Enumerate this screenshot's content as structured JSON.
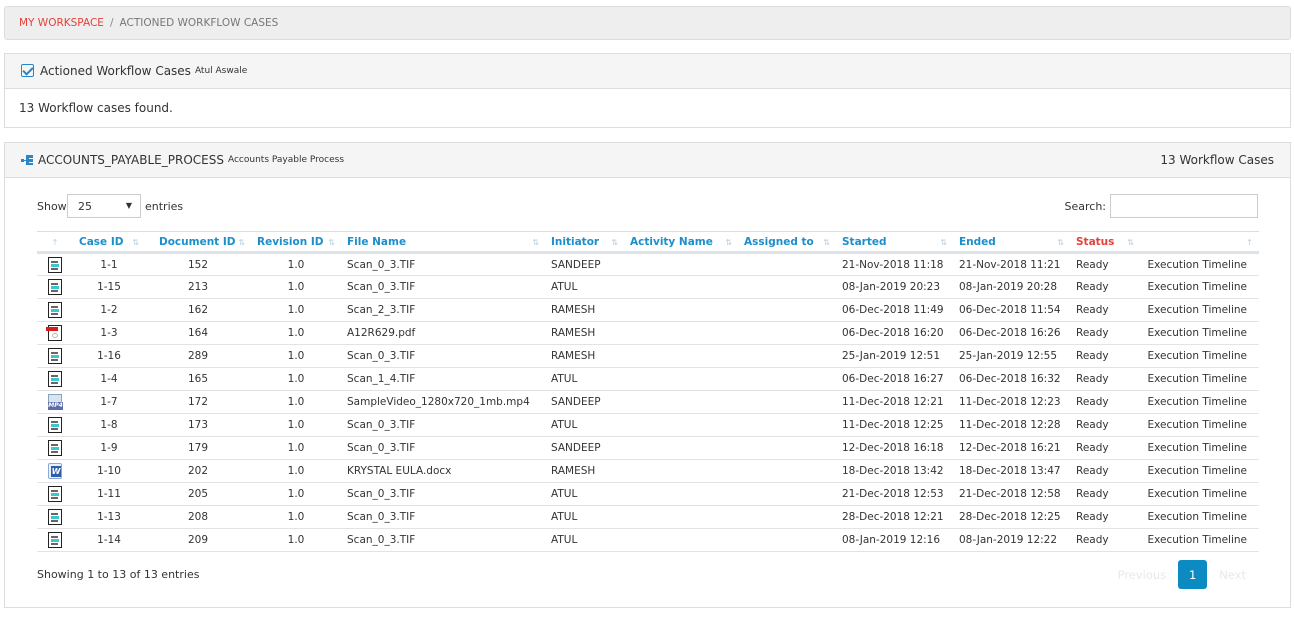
{
  "breadcrumb": {
    "home": "MY WORKSPACE",
    "separator": "/",
    "current": "ACTIONED WORKFLOW CASES"
  },
  "summary_panel": {
    "title": "Actioned Workflow Cases",
    "user": "Atul Aswale",
    "message": "13 Workflow cases found."
  },
  "process_panel": {
    "process_code": "ACCOUNTS_PAYABLE_PROCESS",
    "process_name": "Accounts Payable Process",
    "count_label": "13 Workflow Cases",
    "show_label": "Show",
    "page_length": "25",
    "entries_label": "entries",
    "search_label": "Search:",
    "search_value": "",
    "columns": [
      "",
      "Case ID",
      "Document ID",
      "Revision ID",
      "File Name",
      "Initiator",
      "Activity Name",
      "Assigned to",
      "Started",
      "Ended",
      "Status",
      ""
    ],
    "rows": [
      {
        "icon": "tif",
        "case_id": "1-1",
        "document_id": "152",
        "revision_id": "1.0",
        "file_name": "Scan_0_3.TIF",
        "initiator": "SANDEEP",
        "activity_name": "",
        "assigned_to": "",
        "started": "21-Nov-2018 11:18",
        "ended": "21-Nov-2018 11:21",
        "status": "Ready",
        "action": "Execution Timeline"
      },
      {
        "icon": "tif",
        "case_id": "1-15",
        "document_id": "213",
        "revision_id": "1.0",
        "file_name": "Scan_0_3.TIF",
        "initiator": "ATUL",
        "activity_name": "",
        "assigned_to": "",
        "started": "08-Jan-2019 20:23",
        "ended": "08-Jan-2019 20:28",
        "status": "Ready",
        "action": "Execution Timeline"
      },
      {
        "icon": "tif",
        "case_id": "1-2",
        "document_id": "162",
        "revision_id": "1.0",
        "file_name": "Scan_2_3.TIF",
        "initiator": "RAMESH",
        "activity_name": "",
        "assigned_to": "",
        "started": "06-Dec-2018 11:49",
        "ended": "06-Dec-2018 11:54",
        "status": "Ready",
        "action": "Execution Timeline"
      },
      {
        "icon": "pdf",
        "case_id": "1-3",
        "document_id": "164",
        "revision_id": "1.0",
        "file_name": "A12R629.pdf",
        "initiator": "RAMESH",
        "activity_name": "",
        "assigned_to": "",
        "started": "06-Dec-2018 16:20",
        "ended": "06-Dec-2018 16:26",
        "status": "Ready",
        "action": "Execution Timeline"
      },
      {
        "icon": "tif",
        "case_id": "1-16",
        "document_id": "289",
        "revision_id": "1.0",
        "file_name": "Scan_0_3.TIF",
        "initiator": "RAMESH",
        "activity_name": "",
        "assigned_to": "",
        "started": "25-Jan-2019 12:51",
        "ended": "25-Jan-2019 12:55",
        "status": "Ready",
        "action": "Execution Timeline"
      },
      {
        "icon": "tif",
        "case_id": "1-4",
        "document_id": "165",
        "revision_id": "1.0",
        "file_name": "Scan_1_4.TIF",
        "initiator": "ATUL",
        "activity_name": "",
        "assigned_to": "",
        "started": "06-Dec-2018 16:27",
        "ended": "06-Dec-2018 16:32",
        "status": "Ready",
        "action": "Execution Timeline"
      },
      {
        "icon": "mp4",
        "case_id": "1-7",
        "document_id": "172",
        "revision_id": "1.0",
        "file_name": "SampleVideo_1280x720_1mb.mp4",
        "initiator": "SANDEEP",
        "activity_name": "",
        "assigned_to": "",
        "started": "11-Dec-2018 12:21",
        "ended": "11-Dec-2018 12:23",
        "status": "Ready",
        "action": "Execution Timeline"
      },
      {
        "icon": "tif",
        "case_id": "1-8",
        "document_id": "173",
        "revision_id": "1.0",
        "file_name": "Scan_0_3.TIF",
        "initiator": "ATUL",
        "activity_name": "",
        "assigned_to": "",
        "started": "11-Dec-2018 12:25",
        "ended": "11-Dec-2018 12:28",
        "status": "Ready",
        "action": "Execution Timeline"
      },
      {
        "icon": "tif",
        "case_id": "1-9",
        "document_id": "179",
        "revision_id": "1.0",
        "file_name": "Scan_0_3.TIF",
        "initiator": "SANDEEP",
        "activity_name": "",
        "assigned_to": "",
        "started": "12-Dec-2018 16:18",
        "ended": "12-Dec-2018 16:21",
        "status": "Ready",
        "action": "Execution Timeline"
      },
      {
        "icon": "docx",
        "case_id": "1-10",
        "document_id": "202",
        "revision_id": "1.0",
        "file_name": "KRYSTAL EULA.docx",
        "initiator": "RAMESH",
        "activity_name": "",
        "assigned_to": "",
        "started": "18-Dec-2018 13:42",
        "ended": "18-Dec-2018 13:47",
        "status": "Ready",
        "action": "Execution Timeline"
      },
      {
        "icon": "tif",
        "case_id": "1-11",
        "document_id": "205",
        "revision_id": "1.0",
        "file_name": "Scan_0_3.TIF",
        "initiator": "ATUL",
        "activity_name": "",
        "assigned_to": "",
        "started": "21-Dec-2018 12:53",
        "ended": "21-Dec-2018 12:58",
        "status": "Ready",
        "action": "Execution Timeline"
      },
      {
        "icon": "tif",
        "case_id": "1-13",
        "document_id": "208",
        "revision_id": "1.0",
        "file_name": "Scan_0_3.TIF",
        "initiator": "ATUL",
        "activity_name": "",
        "assigned_to": "",
        "started": "28-Dec-2018 12:21",
        "ended": "28-Dec-2018 12:25",
        "status": "Ready",
        "action": "Execution Timeline"
      },
      {
        "icon": "tif",
        "case_id": "1-14",
        "document_id": "209",
        "revision_id": "1.0",
        "file_name": "Scan_0_3.TIF",
        "initiator": "ATUL",
        "activity_name": "",
        "assigned_to": "",
        "started": "08-Jan-2019 12:16",
        "ended": "08-Jan-2019 12:22",
        "status": "Ready",
        "action": "Execution Timeline"
      }
    ],
    "info": "Showing 1 to 13 of 13 entries",
    "pagination": {
      "previous": "Previous",
      "current_page": "1",
      "next": "Next"
    }
  },
  "colors": {
    "accent_blue": "#1a8fcb",
    "accent_red": "#e5413a",
    "pager_active": "#0b8bc1"
  }
}
